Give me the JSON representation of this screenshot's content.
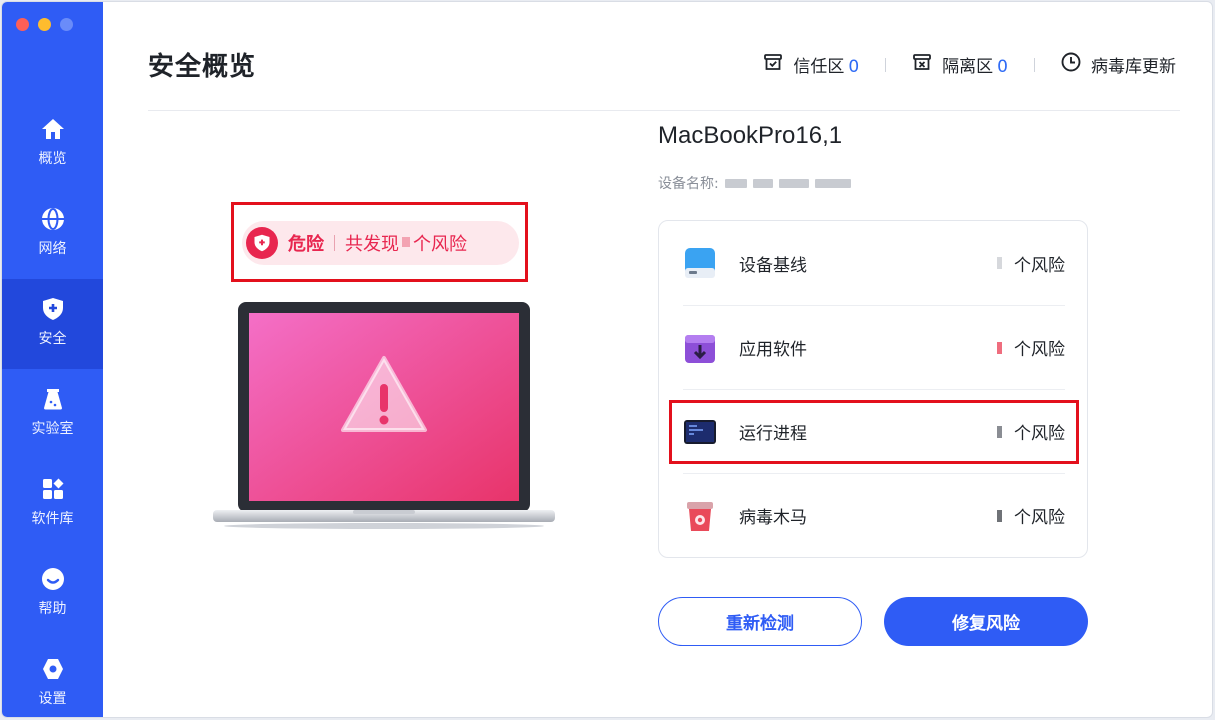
{
  "sidebar": {
    "items": [
      {
        "label": "概览",
        "icon": "home-icon"
      },
      {
        "label": "网络",
        "icon": "globe-icon"
      },
      {
        "label": "安全",
        "icon": "shield-plus-icon",
        "active": true
      },
      {
        "label": "实验室",
        "icon": "flask-icon"
      },
      {
        "label": "软件库",
        "icon": "apps-icon"
      },
      {
        "label": "帮助",
        "icon": "help-icon"
      },
      {
        "label": "设置",
        "icon": "settings-icon"
      }
    ]
  },
  "header": {
    "title": "安全概览",
    "trust_zone": {
      "label": "信任区",
      "count": "0",
      "icon": "trust-box-icon"
    },
    "quarantine": {
      "label": "隔离区",
      "count": "0",
      "icon": "quarantine-box-icon"
    },
    "virus_db": {
      "label": "病毒库更新",
      "icon": "clock-icon"
    }
  },
  "status": {
    "level": "危险",
    "found_prefix": "共发现",
    "found_suffix": "个风险",
    "color": "#e8264f"
  },
  "device": {
    "model": "MacBookPro16,1",
    "name_label": "设备名称:"
  },
  "risks": [
    {
      "name": "设备基线",
      "suffix": "个风险",
      "icon": "disk-icon"
    },
    {
      "name": "应用软件",
      "suffix": "个风险",
      "icon": "app-download-icon"
    },
    {
      "name": "运行进程",
      "suffix": "个风险",
      "icon": "terminal-icon"
    },
    {
      "name": "病毒木马",
      "suffix": "个风险",
      "icon": "virus-bin-icon"
    }
  ],
  "buttons": {
    "rescan": "重新检测",
    "fix": "修复风险"
  },
  "colors": {
    "brand": "#2f5cf5",
    "danger": "#e8264f",
    "highlight_box": "#e3101c"
  }
}
